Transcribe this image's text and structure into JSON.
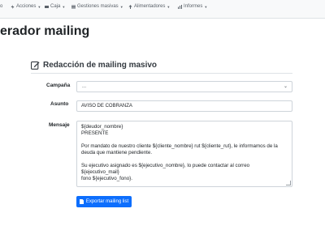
{
  "nav": {
    "items": [
      {
        "label": "o",
        "icon": "menu-icon"
      },
      {
        "label": "Acciones",
        "icon": "bolt-icon"
      },
      {
        "label": "Caja",
        "icon": "cash-icon"
      },
      {
        "label": "Gestiones masivas",
        "icon": "list-icon"
      },
      {
        "label": "Alimentadores",
        "icon": "upload-icon"
      },
      {
        "label": "Informes",
        "icon": "chart-icon"
      }
    ]
  },
  "page": {
    "title": "erador mailing"
  },
  "section": {
    "title": "Redacción de mailing masivo"
  },
  "form": {
    "campana_label": "Campaña",
    "campana_value": "...",
    "asunto_label": "Asunto",
    "asunto_value": "AVISO DE COBRANZA",
    "mensaje_label": "Mensaje",
    "mensaje_lines": {
      "l1": "${deudor_nombre}",
      "l2": "PRESENTE",
      "l3": "Por mandato de nuestro cliente ${cliente_nombre} rut ${cliente_rut}, le informamos de la",
      "l4": "deuda que mantiene pendiente.",
      "l5": "Su ejecutivo asignado es ${ejecutivo_nombre}, lo puede contactar al correo ${ejecutivo_mail}",
      "l6": "fono ${ejecutivo_fono}."
    }
  },
  "button": {
    "export_label": "Exportar mailing list"
  },
  "colors": {
    "primary": "#0d6efd",
    "navbar_bg": "#f8f9fa"
  }
}
